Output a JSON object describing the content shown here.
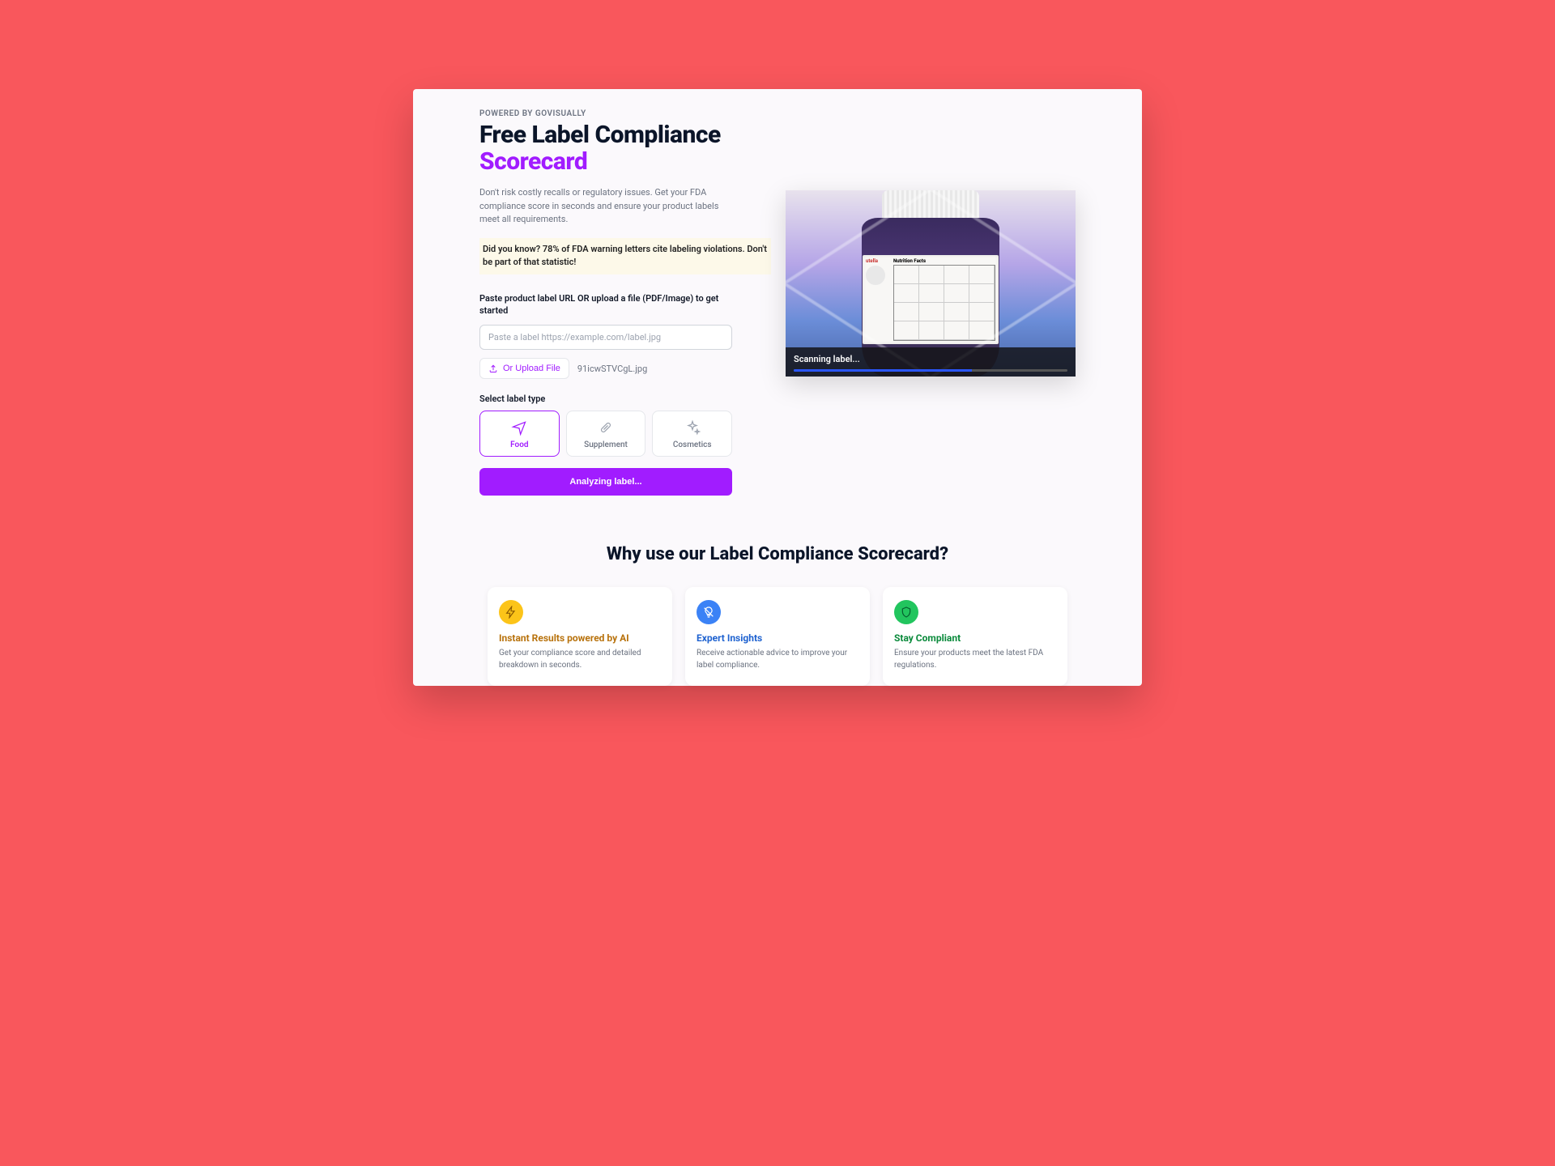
{
  "header": {
    "kicker": "POWERED BY GOVISUALLY",
    "headline_main": "Free Label Compliance",
    "headline_accent": "Scorecard",
    "tagline": "Don't risk costly recalls or regulatory issues. Get your FDA compliance score in seconds and ensure your product labels meet all requirements.",
    "callout": "Did you know? 78% of FDA warning letters cite labeling violations. Don't be part of that statistic!"
  },
  "form": {
    "url_label": "Paste product label URL OR upload a file (PDF/Image) to get started",
    "url_placeholder": "Paste a label https://example.com/label.jpg",
    "upload_label": "Or Upload File",
    "uploaded_filename": "91icwSTVCgL.jpg",
    "type_label": "Select label type",
    "types": [
      {
        "label": "Food",
        "active": true
      },
      {
        "label": "Supplement",
        "active": false
      },
      {
        "label": "Cosmetics",
        "active": false
      }
    ],
    "submit_label": "Analyzing label..."
  },
  "preview": {
    "brand": "utella",
    "nutrition_label": "Nutrition Facts",
    "status": "Scanning label...",
    "progress_pct": 65
  },
  "why": {
    "title": "Why use our Label Compliance Scorecard?",
    "features": [
      {
        "title": "Instant Results powered by AI",
        "desc": "Get your compliance score and detailed breakdown in seconds.",
        "color": "yellow",
        "icon": "lightning"
      },
      {
        "title": "Expert Insights",
        "desc": "Receive actionable advice to improve your label compliance.",
        "color": "blue",
        "icon": "lightbulb"
      },
      {
        "title": "Stay Compliant",
        "desc": "Ensure your products meet the latest FDA regulations.",
        "color": "green",
        "icon": "shield"
      }
    ]
  }
}
